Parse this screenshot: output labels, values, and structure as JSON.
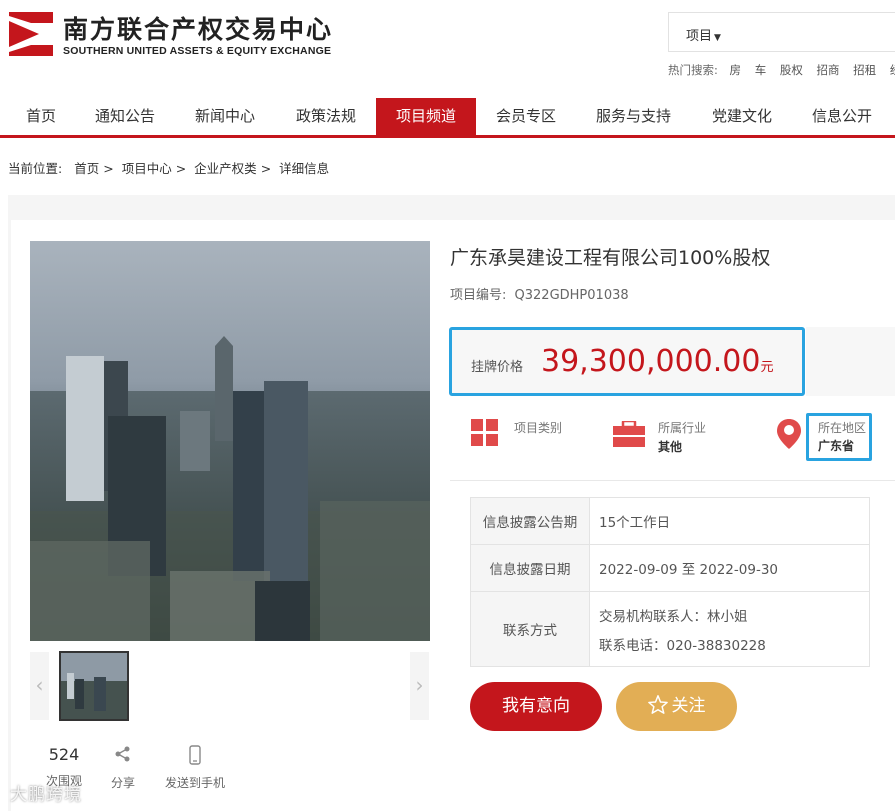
{
  "header": {
    "logo_cn": "南方联合产权交易中心",
    "logo_en": "SOUTHERN UNITED ASSETS & EQUITY EXCHANGE",
    "brand_color": "#c4161c",
    "search_select": "项目",
    "hot_label": "热门搜索:",
    "hot_items": [
      "房",
      "车",
      "股权",
      "招商",
      "招租",
      "经"
    ]
  },
  "nav": {
    "items": [
      "首页",
      "通知公告",
      "新闻中心",
      "政策法规",
      "项目频道",
      "会员专区",
      "服务与支持",
      "党建文化",
      "信息公开"
    ],
    "active_index": 4
  },
  "breadcrumb": {
    "prefix": "当前位置:",
    "items": [
      "首页",
      "项目中心",
      "企业产权类",
      "详细信息"
    ]
  },
  "gallery": {
    "prev_icon": "chevron-left-icon",
    "next_icon": "chevron-right-icon"
  },
  "stats": {
    "views_count": "524",
    "views_label": "次围观",
    "share_label": "分享",
    "phone_label": "发送到手机"
  },
  "watermark": "大鹏跨境",
  "project": {
    "title": "广东承昊建设工程有限公司100%股权",
    "code_label": "项目编号:",
    "code_value": "Q322GDHP01038",
    "price_label": "挂牌价格",
    "price_value": "39,300,000.00",
    "price_unit": "元",
    "category_label": "项目类别",
    "industry_label": "所属行业",
    "industry_value": "其他",
    "region_label": "所在地区",
    "region_value": "广东省"
  },
  "info_table": {
    "rows": [
      {
        "label": "信息披露公告期",
        "value": "15个工作日"
      },
      {
        "label": "信息披露日期",
        "value": "2022-09-09 至 2022-09-30"
      },
      {
        "label": "联系方式",
        "contact_person": "交易机构联系人：林小姐",
        "contact_phone": "联系电话：020-38830228"
      }
    ]
  },
  "actions": {
    "intent_label": "我有意向",
    "follow_label": "关注"
  }
}
